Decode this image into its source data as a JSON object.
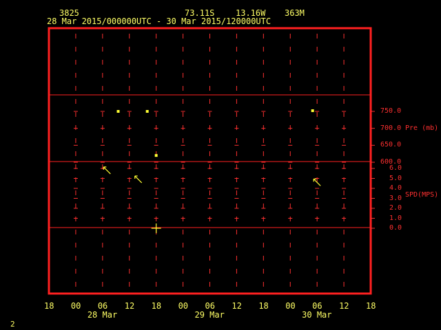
{
  "header": {
    "station_id": "3825",
    "latitude": "73.11S",
    "longitude": "13.16W",
    "elevation": "363M",
    "time_range": "28 Mar 2015/000000UTC - 30 Mar 2015/120000UTC"
  },
  "footer": {
    "page_number": "2"
  },
  "colors": {
    "background": "#000000",
    "frame": "#ff2020",
    "grid": "#ff3030",
    "data": "#ffff33",
    "text": "#ffff66"
  },
  "chart_data": {
    "type": "scatter",
    "title": "",
    "x_tick_labels": [
      "18",
      "00",
      "06",
      "12",
      "18",
      "00",
      "06",
      "12",
      "18",
      "00",
      "06",
      "12",
      "18"
    ],
    "x_day_labels": [
      "28 Mar",
      "29 Mar",
      "30 Mar"
    ],
    "x_range_hours": [
      -6,
      66
    ],
    "pressure_axis": {
      "label": "Pre (mb)",
      "ticks": [
        "750.0",
        "700.0",
        "650.0",
        "600.0"
      ],
      "range": [
        600,
        750
      ]
    },
    "speed_axis": {
      "label": "SPD(MPS)",
      "ticks": [
        "6.0",
        "5.0",
        "4.0",
        "3.0",
        "2.0",
        "1.0",
        "0.0"
      ],
      "range": [
        0,
        6
      ]
    },
    "pressure_points": [
      {
        "hours": 9.5,
        "pressure": 750
      },
      {
        "hours": 16,
        "pressure": 750
      },
      {
        "hours": 18,
        "pressure": 620
      },
      {
        "hours": 53,
        "pressure": 752
      }
    ],
    "wind_points": [
      {
        "hours": 7,
        "speed": 5.8,
        "direction": "NW"
      },
      {
        "hours": 14,
        "speed": 4.9,
        "direction": "NW"
      },
      {
        "hours": 54,
        "speed": 4.6,
        "direction": "NW"
      }
    ],
    "calm_marker": {
      "hours": 18,
      "speed": 0
    },
    "legend": "none"
  }
}
